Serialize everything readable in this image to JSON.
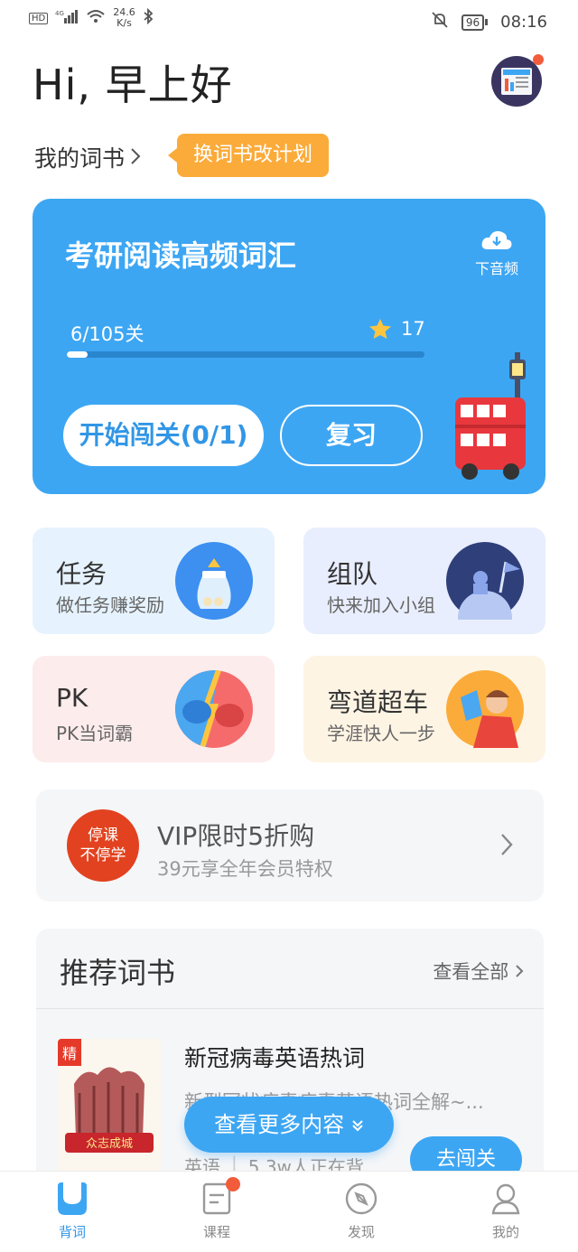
{
  "status_bar": {
    "speed": "24.6",
    "speed_unit": "K/s",
    "battery": "96",
    "time": "08:16"
  },
  "header": {
    "greeting": "Hi, 早上好"
  },
  "my_book": {
    "label": "我的词书",
    "change_plan": "换词书改计划"
  },
  "main_card": {
    "title": "考研阅读高频词汇",
    "download_label": "下音频",
    "progress_text": "6/105关",
    "progress_fraction": 0.057,
    "stars": "17",
    "start_button": "开始闯关(0/1)",
    "review_button": "复习"
  },
  "tiles": [
    {
      "title": "任务",
      "subtitle": "做任务赚奖励"
    },
    {
      "title": "组队",
      "subtitle": "快来加入小组"
    },
    {
      "title": "PK",
      "subtitle": "PK当词霸"
    },
    {
      "title": "弯道超车",
      "subtitle": "学涯快人一步"
    }
  ],
  "vip": {
    "badge_line1": "停课",
    "badge_line2": "不停学",
    "title": "VIP限时5折购",
    "subtitle": "39元享全年会员特权"
  },
  "recommend": {
    "title": "推荐词书",
    "view_all": "查看全部",
    "book": {
      "tag": "精",
      "cover_text": "众志成城",
      "title": "新冠病毒英语热词",
      "desc": "新型冠状病毒病毒英语热词全解~...",
      "lang": "英语",
      "learners": "5.3w人正在背",
      "go_button": "去闯关"
    }
  },
  "see_more": "查看更多内容",
  "tabbar": [
    {
      "label": "背词"
    },
    {
      "label": "课程"
    },
    {
      "label": "发现"
    },
    {
      "label": "我的"
    }
  ],
  "colors": {
    "primary": "#3da6f3",
    "orange": "#fbab3a",
    "red": "#f25c3b"
  }
}
